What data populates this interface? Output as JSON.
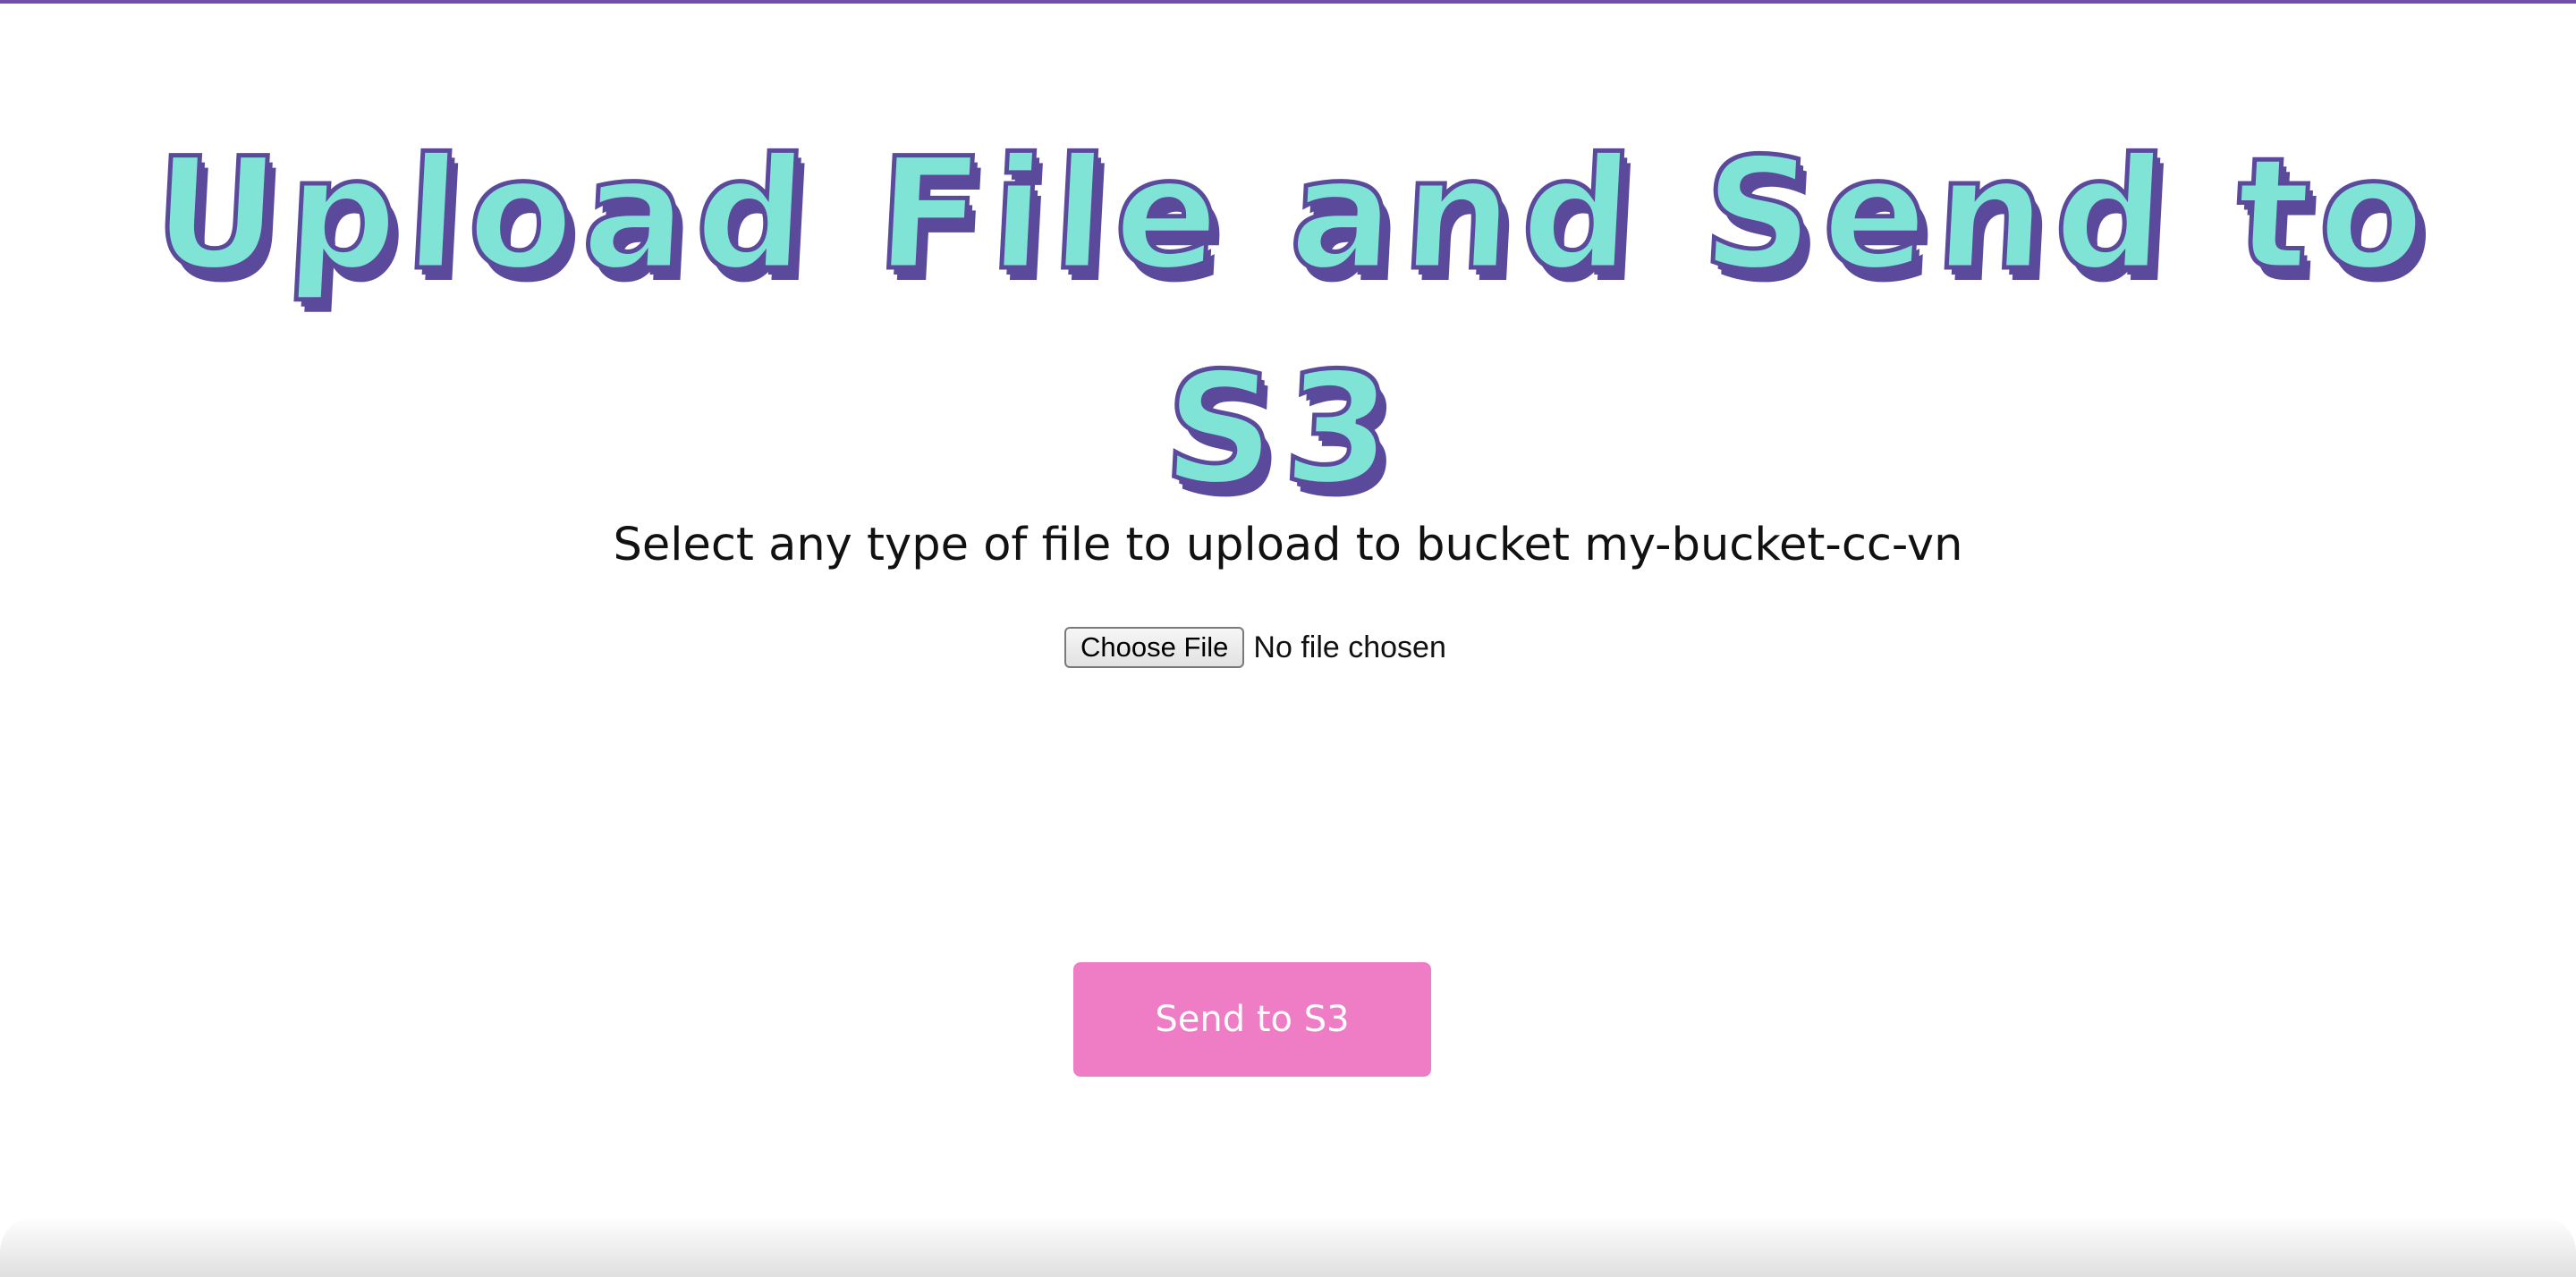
{
  "header": {
    "title": "Upload File and Send to S3"
  },
  "form": {
    "instruction_prefix": "Select any type of file to upload to bucket ",
    "bucket_name": "my-bucket-cc-vn",
    "choose_file_label": "Choose File",
    "file_status": "No file chosen",
    "submit_label": "Send to S3"
  },
  "colors": {
    "accent_border": "#6f4fa8",
    "title_fill": "#7fe3d6",
    "title_outline": "#5b4a9c",
    "button_bg": "#ef7dc6"
  }
}
